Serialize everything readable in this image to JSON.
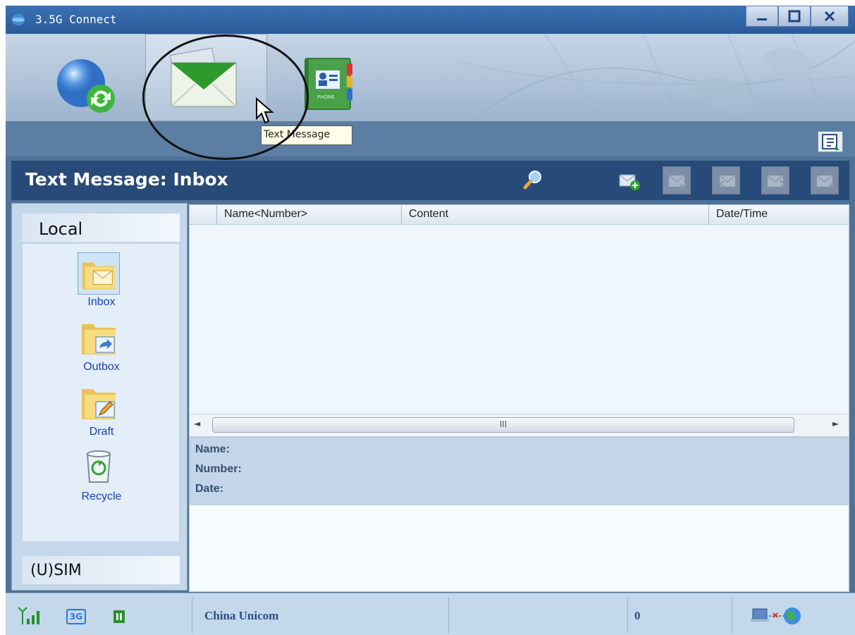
{
  "window": {
    "title": "3.5G Connect"
  },
  "toolbar": {
    "buttons": [
      {
        "name": "connect",
        "icon": "globe-refresh-icon"
      },
      {
        "name": "text_message",
        "icon": "envelope-icon",
        "selected": true
      },
      {
        "name": "phonebook",
        "icon": "phonebook-icon",
        "label": "PHONE"
      }
    ],
    "tooltip": "Text Message"
  },
  "header": {
    "title": "Text Message: Inbox",
    "actions": [
      "search-icon",
      "new-message-icon",
      "delete-message-icon",
      "reply-icon",
      "forward-icon",
      "resend-icon"
    ]
  },
  "sidebar": {
    "local_label": "Local",
    "items": [
      {
        "label": "Inbox",
        "icon": "inbox-folder-icon",
        "selected": true
      },
      {
        "label": "Outbox",
        "icon": "outbox-folder-icon"
      },
      {
        "label": "Draft",
        "icon": "draft-folder-icon"
      },
      {
        "label": "Recycle",
        "icon": "recycle-bin-icon"
      }
    ],
    "sim_label": "(U)SIM"
  },
  "list": {
    "columns": [
      "Name<Number>",
      "Content",
      "Date/Time"
    ],
    "rows": [],
    "scroll_thumb_label": "III"
  },
  "detail": {
    "name_label": "Name:",
    "number_label": "Number:",
    "date_label": "Date:"
  },
  "status": {
    "network_type": "3G",
    "operator": "China Unicom",
    "count": "0"
  },
  "colors": {
    "titlebar": "#2c5a98",
    "header": "#284a78",
    "status_text": "#2a4f86",
    "link_blue": "#1c3fbd"
  }
}
